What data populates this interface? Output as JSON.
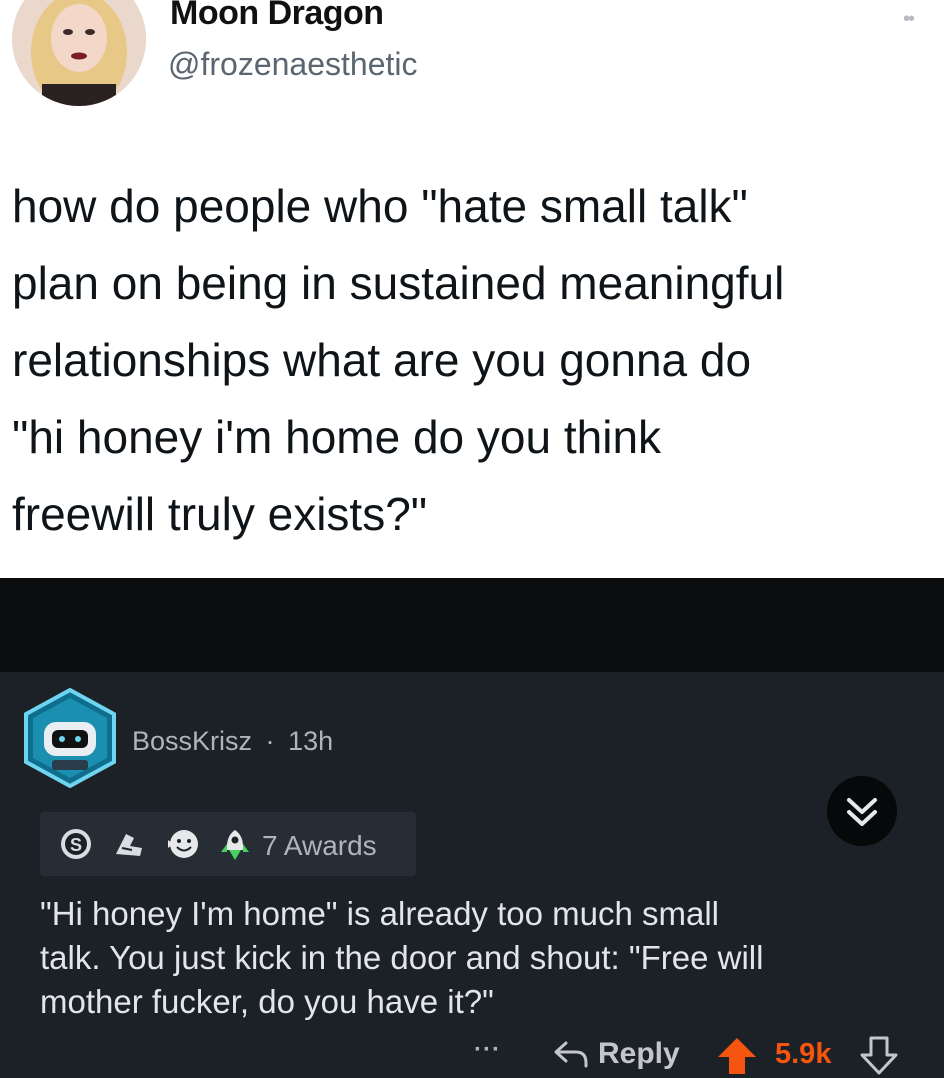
{
  "tweet": {
    "author_name": "Moon Dragon",
    "author_handle": "@frozenaesthetic",
    "more_icon": "more-dots-icon",
    "text": "how do people who \"hate small talk\"\nplan on being in sustained meaningful\nrelationships what are you gonna do\n\"hi honey i'm home do you think\nfreewill truly exists?\""
  },
  "comment": {
    "username": "BossKrisz",
    "separator": "·",
    "time": "13h",
    "awards_label": "7 Awards",
    "award_icons": [
      "silver-award-icon",
      "helpful-award-icon",
      "wholesome-award-icon",
      "rocket-award-icon"
    ],
    "text": "\"Hi honey I'm home\" is already too much small\ntalk. You just kick in the door and shout: \"Free will\nmother fucker, do you have it?\"",
    "actions": {
      "more": "···",
      "reply": "Reply",
      "score": "5.9k"
    }
  },
  "colors": {
    "tweet_bg": "#ffffff",
    "reddit_bg": "#1c2127",
    "upvote": "#f5550f",
    "text_light": "#e3e6e8",
    "meta_gray": "#aeb4ba"
  }
}
